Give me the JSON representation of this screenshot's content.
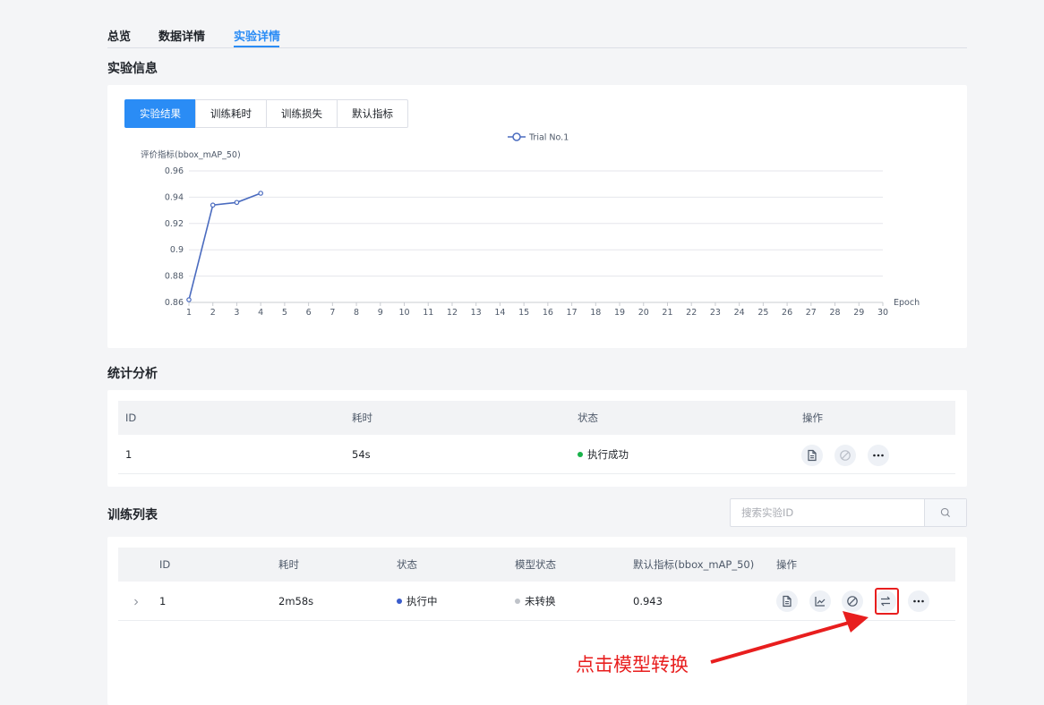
{
  "tabs": [
    {
      "label": "总览"
    },
    {
      "label": "数据详情"
    },
    {
      "label": "实验详情"
    }
  ],
  "experiment_info": {
    "title": "实验信息",
    "buttons": [
      {
        "label": "实验结果"
      },
      {
        "label": "训练耗时"
      },
      {
        "label": "训练损失"
      },
      {
        "label": "默认指标"
      }
    ]
  },
  "chart_data": {
    "type": "line",
    "legend": [
      "Trial No.1"
    ],
    "legend_position": "top-center",
    "ylabel": "评价指标(bbox_mAP_50)",
    "xlabel": "Epoch",
    "ylim": [
      0.86,
      0.96
    ],
    "yticks": [
      "0.96",
      "0.94",
      "0.92",
      "0.9",
      "0.88",
      "0.86"
    ],
    "x": [
      1,
      2,
      3,
      4,
      5,
      6,
      7,
      8,
      9,
      10,
      11,
      12,
      13,
      14,
      15,
      16,
      17,
      18,
      19,
      20,
      21,
      22,
      23,
      24,
      25,
      26,
      27,
      28,
      29,
      30
    ],
    "grid": true,
    "series": [
      {
        "name": "Trial No.1",
        "x": [
          1,
          2,
          3,
          4
        ],
        "values": [
          0.862,
          0.934,
          0.936,
          0.943
        ],
        "color": "#4a6bbf"
      }
    ]
  },
  "stats": {
    "title": "统计分析",
    "headers": [
      "ID",
      "耗时",
      "状态",
      "操作"
    ],
    "rows": [
      {
        "id": "1",
        "duration": "54s",
        "status": "执行成功",
        "status_color": "#19b24a",
        "actions": [
          "document-icon",
          "ban-icon",
          "more-icon"
        ]
      }
    ]
  },
  "training": {
    "title": "训练列表",
    "search_placeholder": "搜索实验ID",
    "headers": [
      "ID",
      "耗时",
      "状态",
      "模型状态",
      "默认指标(bbox_mAP_50)",
      "操作"
    ],
    "rows": [
      {
        "id": "1",
        "duration": "2m58s",
        "status": "执行中",
        "status_color": "#3a5ccc",
        "model_status": "未转换",
        "model_status_color": "#bfc3c9",
        "metric": "0.943",
        "actions": [
          "document-icon",
          "chart-icon",
          "ban-icon",
          "convert-icon",
          "more-icon"
        ]
      }
    ]
  },
  "annotation": {
    "text": "点击模型转换",
    "color": "#e81e1e"
  }
}
